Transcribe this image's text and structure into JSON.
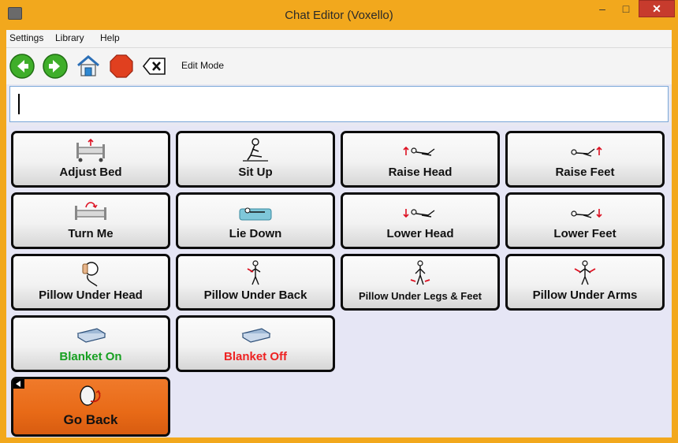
{
  "window": {
    "title": "Chat Editor (Voxello)"
  },
  "titlebar_buttons": {
    "minimize": "–",
    "maximize": "□",
    "close": "✕"
  },
  "menu": [
    "Settings",
    "Library",
    "Help"
  ],
  "toolbar": {
    "edit_mode": "Edit Mode"
  },
  "message_bar": {
    "value": ""
  },
  "tiles": {
    "adjust_bed": "Adjust Bed",
    "sit_up": "Sit Up",
    "raise_head": "Raise Head",
    "raise_feet": "Raise Feet",
    "turn_me": "Turn Me",
    "lie_down": "Lie  Down",
    "lower_head": "Lower Head",
    "lower_feet": "Lower Feet",
    "pillow_under_head": "Pillow Under Head",
    "pillow_under_back": "Pillow Under Back",
    "pillow_under_legs": "Pillow Under Legs & Feet",
    "pillow_under_arms": "Pillow Under Arms",
    "blanket_on": "Blanket On",
    "blanket_off": "Blanket Off",
    "go_back": "Go Back"
  },
  "colors": {
    "window_frame": "#f2a81d",
    "close_button": "#c73b2d",
    "go_back_tile": "#e86a17",
    "blanket_on_text": "#17a021",
    "blanket_off_text": "#ee2222"
  }
}
